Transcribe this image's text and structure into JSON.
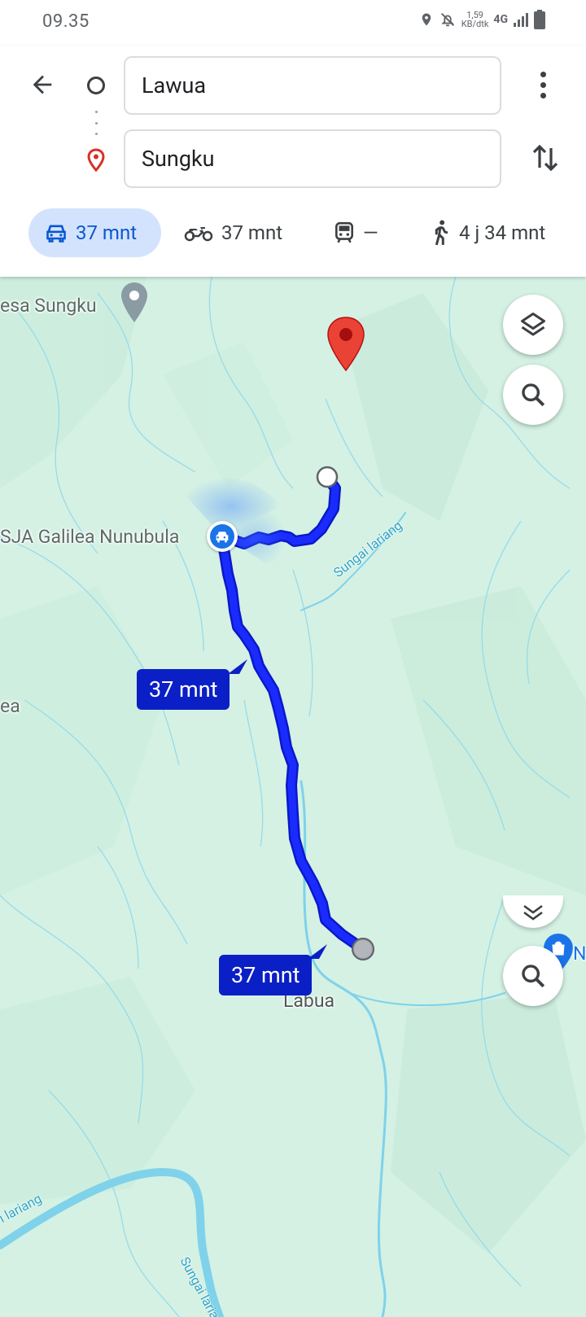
{
  "status_bar": {
    "time": "09.35",
    "net_speed_value": "1,59",
    "net_speed_unit": "KB/dtk",
    "network": "4G"
  },
  "header": {
    "origin_value": "Lawua",
    "destination_value": "Sungku"
  },
  "travel_modes": [
    {
      "mode": "drive",
      "icon": "car-icon",
      "time": "37 mnt",
      "selected": true
    },
    {
      "mode": "motorcycle",
      "icon": "motorcycle-icon",
      "time": "37 mnt",
      "selected": false
    },
    {
      "mode": "transit",
      "icon": "train-icon",
      "time": "—",
      "selected": false
    },
    {
      "mode": "walk",
      "icon": "walk-icon",
      "time": "4 j 34 mnt",
      "selected": false
    }
  ],
  "map": {
    "labels": {
      "desa_sungku": "esa Sungku",
      "galilea": "SJA Galilea Nunubula",
      "left_fragment": "ea",
      "labua": "Labua",
      "right_fragment": "N"
    },
    "rivers": {
      "sungai_lariang_top": "Sungai lariang",
      "sungai_lariang_bottom_left": "i lariang",
      "sungai_lariang_bottom": "Sungai lariang"
    },
    "route_chips": {
      "upper": "37 mnt",
      "lower": "37 mnt"
    },
    "colors": {
      "route": "#1a2bff",
      "route_outline": "#0a19c6",
      "chip": "#0b1fc6",
      "map_bg": "#d4f1e4",
      "water": "#7fd2ea",
      "pin": "#ea4335"
    }
  }
}
